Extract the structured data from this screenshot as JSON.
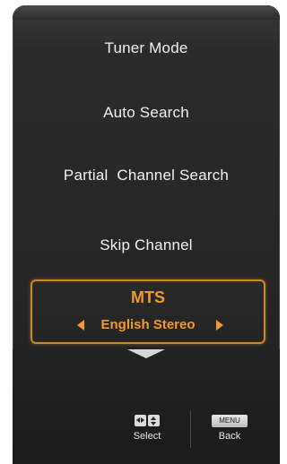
{
  "menu": {
    "items": [
      {
        "label": "Tuner Mode"
      },
      {
        "label": "Auto Search"
      },
      {
        "label": "Partial  Channel Search"
      },
      {
        "label": "Skip Channel"
      }
    ],
    "selected": {
      "title": "MTS",
      "value": "English Stereo"
    }
  },
  "hints": {
    "select_label": "Select",
    "back_key": "MENU",
    "back_label": "Back"
  },
  "colors": {
    "accent": "#f49a2b",
    "border": "#c88a2a",
    "panel": "#262626",
    "text": "#f2f2f2"
  },
  "icons": {
    "left": "chevron-left-icon",
    "right": "chevron-right-icon",
    "down": "chevron-down-icon",
    "dpad": "dpad-icon"
  }
}
